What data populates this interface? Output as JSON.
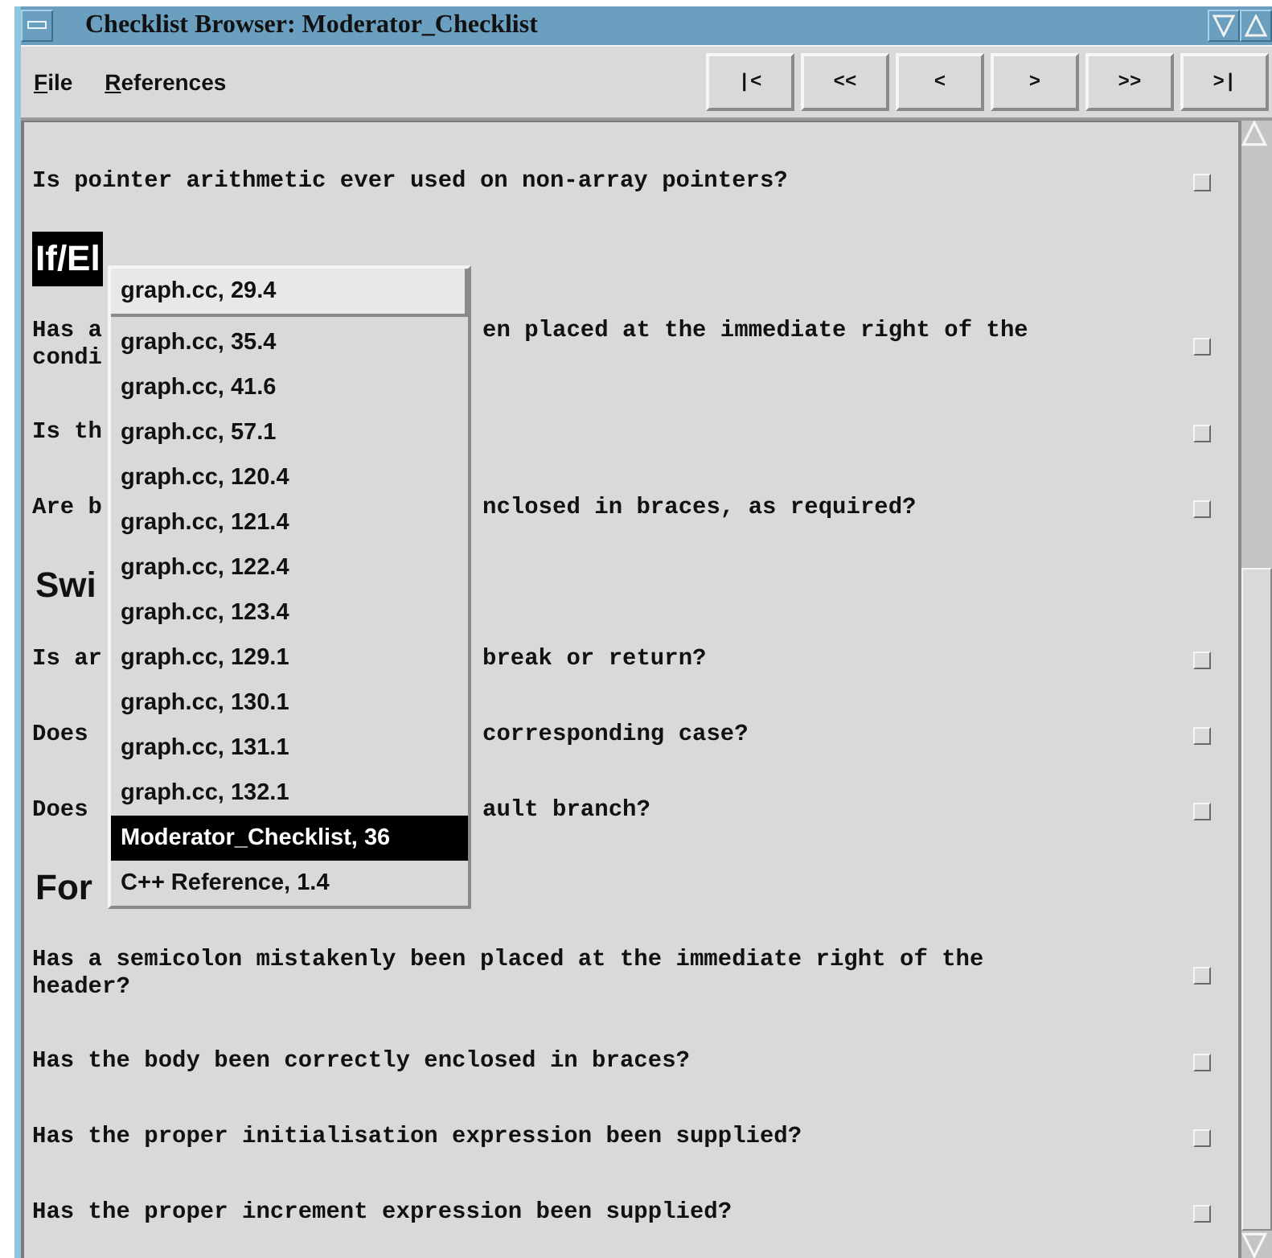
{
  "window": {
    "title": "Checklist Browser: Moderator_Checklist"
  },
  "menu": [
    "File",
    "References"
  ],
  "nav_buttons": [
    "|<",
    "<<",
    "<",
    ">",
    ">>",
    ">|"
  ],
  "checklist": [
    {
      "kind": "question",
      "lines": [
        {
          "text": "Is pointer arithmetic ever used on non-array pointers?"
        }
      ],
      "checked": false
    },
    {
      "kind": "heading",
      "text": "If/El",
      "selected": true
    },
    {
      "kind": "question",
      "lines": [
        {
          "text": "Has a",
          "text_after": "en placed at the immediate right of the"
        },
        {
          "text": "condi"
        }
      ],
      "checked": false
    },
    {
      "kind": "question",
      "lines": [
        {
          "text": "Is th"
        }
      ],
      "checked": false
    },
    {
      "kind": "question",
      "lines": [
        {
          "text": "Are b",
          "text_after": "nclosed in braces, as required?"
        }
      ],
      "checked": false
    },
    {
      "kind": "heading",
      "text": "Swi",
      "selected": false
    },
    {
      "kind": "question",
      "lines": [
        {
          "text": "Is ar",
          "text_after": "break or return?"
        }
      ],
      "checked": false
    },
    {
      "kind": "question",
      "lines": [
        {
          "text": "Does",
          "text_after": "corresponding case?"
        }
      ],
      "checked": false
    },
    {
      "kind": "question",
      "lines": [
        {
          "text": "Does",
          "text_after": "ault branch?"
        }
      ],
      "checked": false
    },
    {
      "kind": "heading",
      "text": "For",
      "selected": false
    },
    {
      "kind": "question",
      "lines": [
        {
          "text": "Has a semicolon mistakenly been placed at the immediate right of the"
        },
        {
          "text": "header?"
        }
      ],
      "checked": false
    },
    {
      "kind": "question",
      "lines": [
        {
          "text": "Has the body been correctly enclosed in braces?"
        }
      ],
      "checked": false
    },
    {
      "kind": "question",
      "lines": [
        {
          "text": "Has the proper initialisation expression been supplied?"
        }
      ],
      "checked": false
    },
    {
      "kind": "question",
      "lines": [
        {
          "text": "Has the proper increment expression been supplied?"
        }
      ],
      "checked": false
    }
  ],
  "popup_menu": {
    "items": [
      {
        "label": "graph.cc, 29.4",
        "kind": "header",
        "selected": false
      },
      {
        "label": "graph.cc, 35.4",
        "kind": "item",
        "selected": false
      },
      {
        "label": "graph.cc, 41.6",
        "kind": "item",
        "selected": false
      },
      {
        "label": "graph.cc, 57.1",
        "kind": "item",
        "selected": false
      },
      {
        "label": "graph.cc, 120.4",
        "kind": "item",
        "selected": false
      },
      {
        "label": "graph.cc, 121.4",
        "kind": "item",
        "selected": false
      },
      {
        "label": "graph.cc, 122.4",
        "kind": "item",
        "selected": false
      },
      {
        "label": "graph.cc, 123.4",
        "kind": "item",
        "selected": false
      },
      {
        "label": "graph.cc, 129.1",
        "kind": "item",
        "selected": false
      },
      {
        "label": "graph.cc, 130.1",
        "kind": "item",
        "selected": false
      },
      {
        "label": "graph.cc, 131.1",
        "kind": "item",
        "selected": false
      },
      {
        "label": "graph.cc, 132.1",
        "kind": "item",
        "selected": false
      },
      {
        "label": "Moderator_Checklist, 36",
        "kind": "item",
        "selected": true
      },
      {
        "label": "C++ Reference, 1.4",
        "kind": "item",
        "selected": false
      }
    ]
  }
}
